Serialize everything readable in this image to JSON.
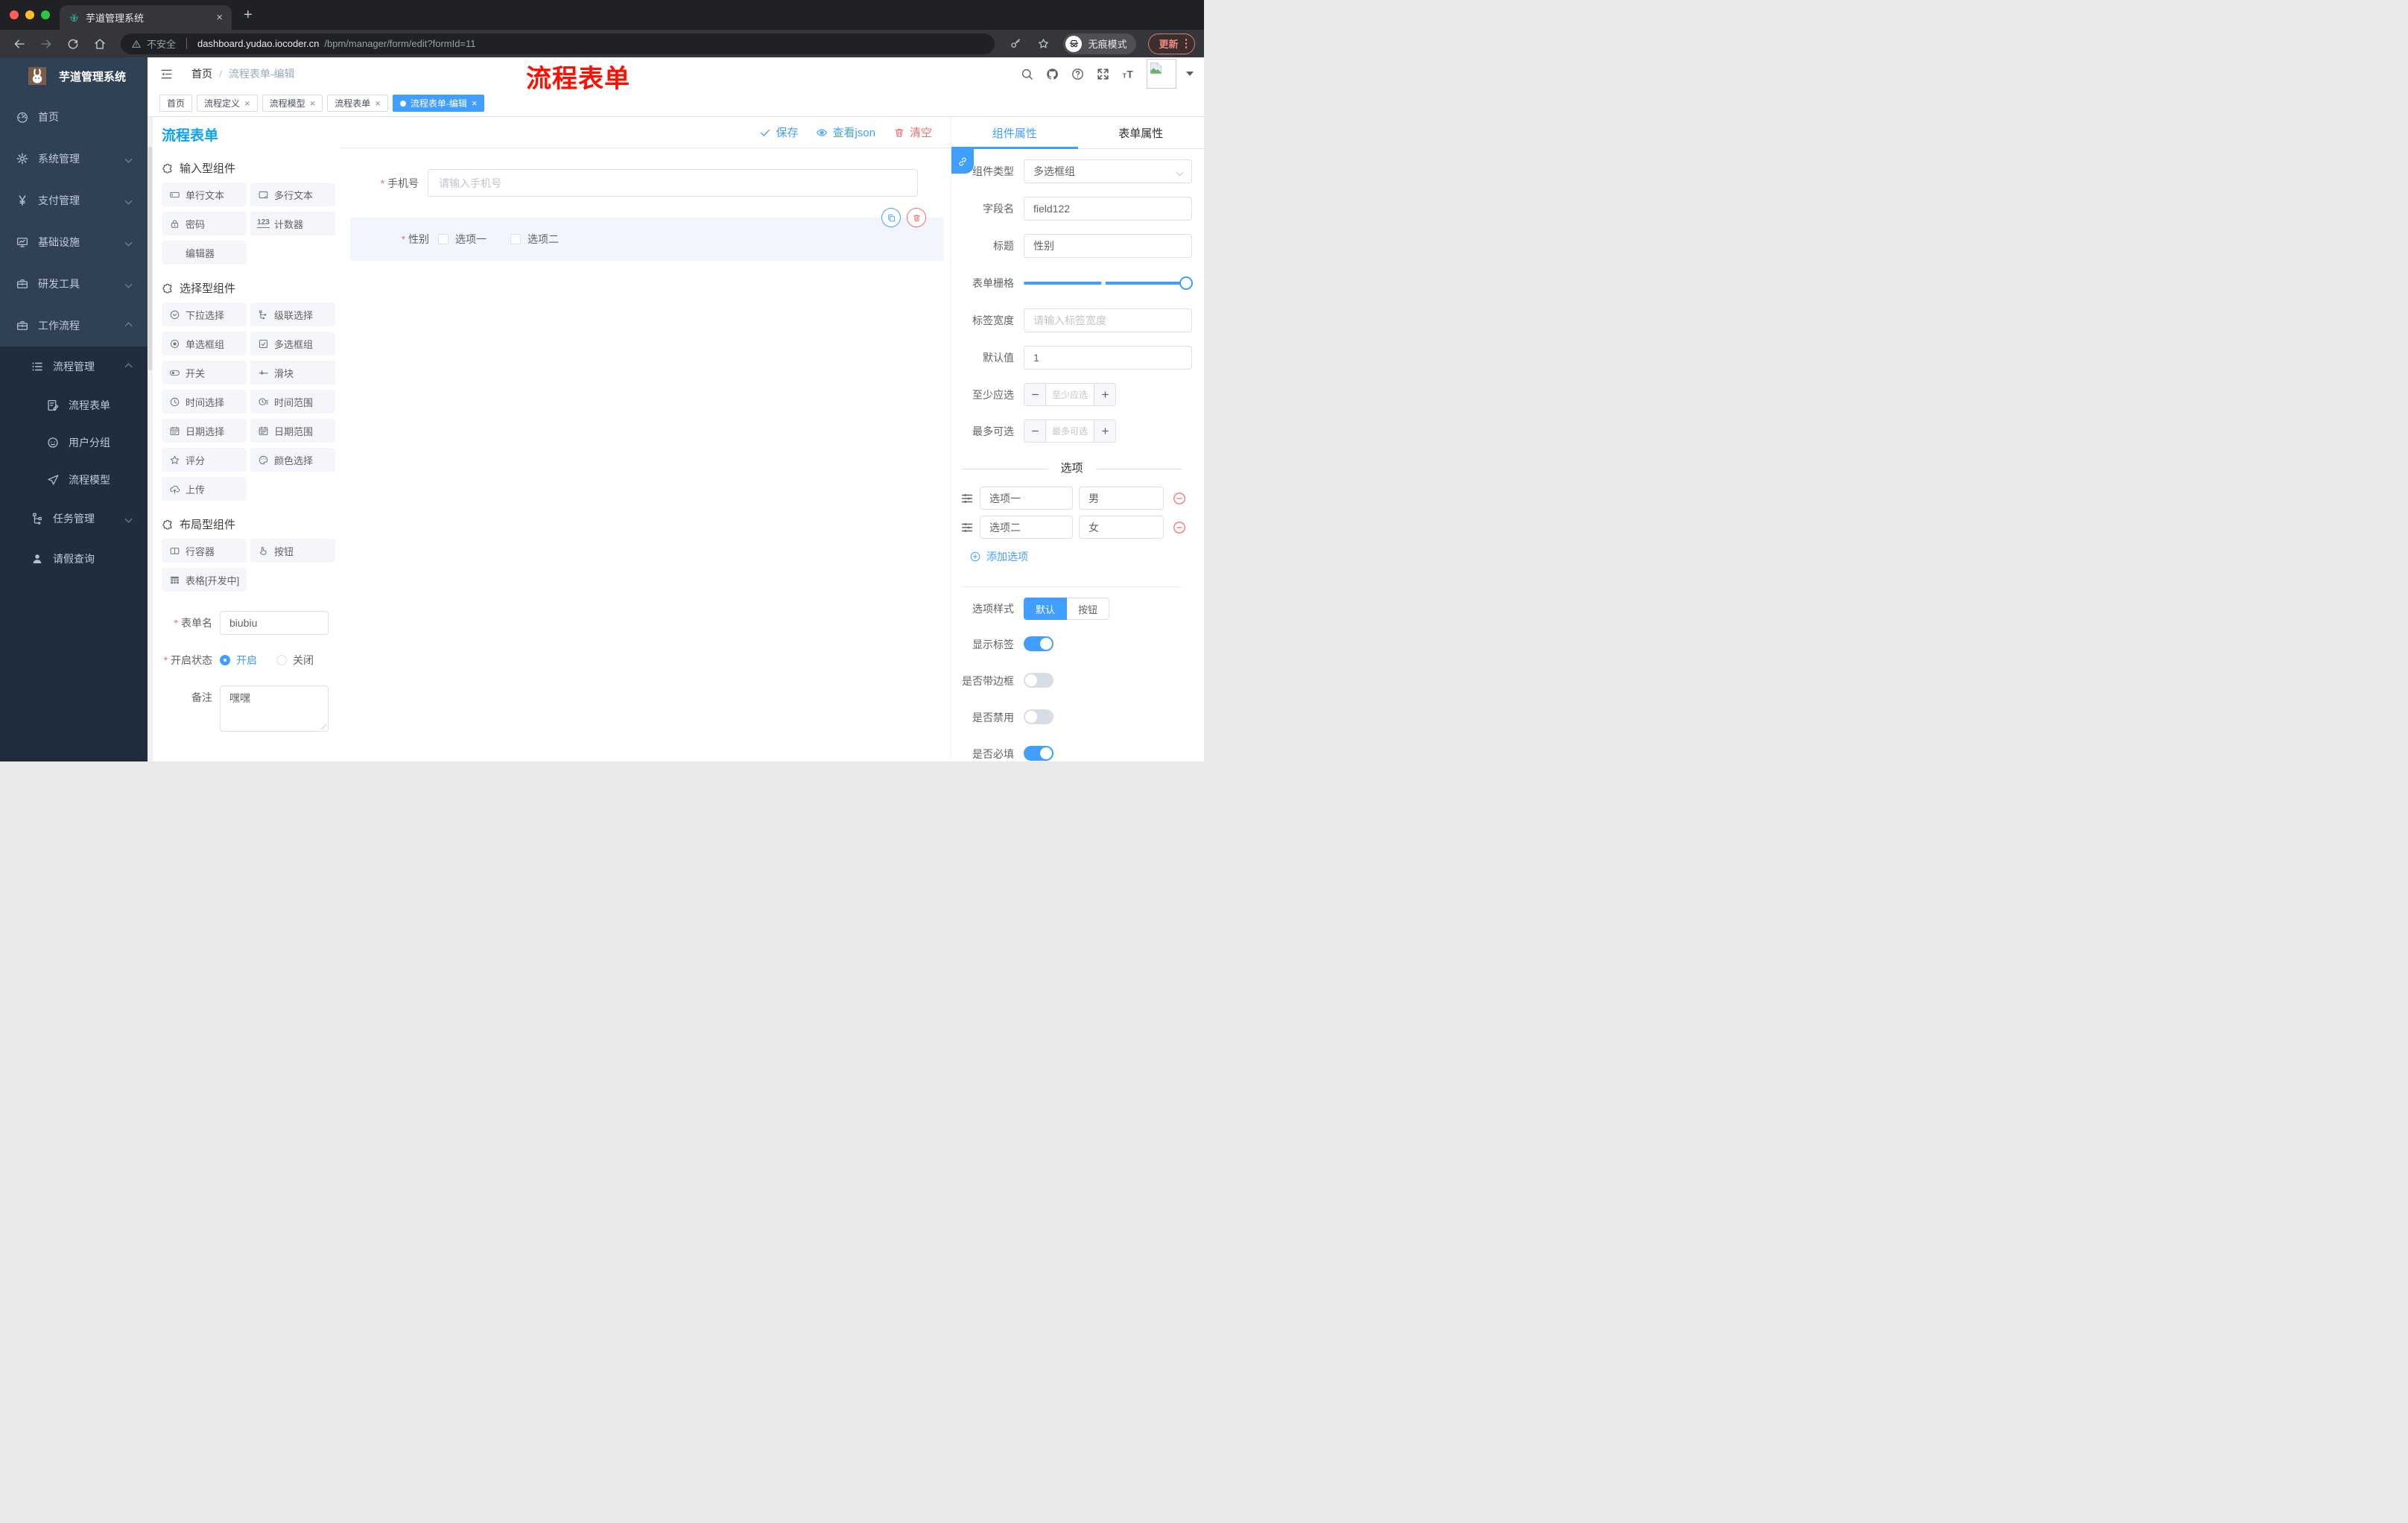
{
  "browser": {
    "tab_title": "芋道管理系统",
    "security_label": "不安全",
    "url_host": "dashboard.yudao.iocoder.cn",
    "url_path": "/bpm/manager/form/edit?formId=11",
    "incognito_label": "无痕模式",
    "update_label": "更新"
  },
  "sidebar": {
    "logo_title": "芋道管理系统",
    "top": [
      {
        "icon": "gauge",
        "label": "首页",
        "arrow": "none",
        "cls": "lvl0"
      },
      {
        "icon": "gear",
        "label": "系统管理",
        "arrow": "down",
        "cls": "lvl0"
      },
      {
        "icon": "yen",
        "label": "支付管理",
        "arrow": "down",
        "cls": "lvl0"
      },
      {
        "icon": "monitor",
        "label": "基础设施",
        "arrow": "down",
        "cls": "lvl0"
      },
      {
        "icon": "toolbox",
        "label": "研发工具",
        "arrow": "down",
        "cls": "lvl0"
      },
      {
        "icon": "toolbox",
        "label": "工作流程",
        "arrow": "up",
        "cls": "lvl0"
      }
    ],
    "sub": [
      {
        "icon": "list",
        "label": "流程管理",
        "arrow": "up",
        "cls": "lvl1"
      },
      {
        "icon": "doc-edit",
        "label": "流程表单",
        "arrow": "none",
        "cls": "lvl2"
      },
      {
        "icon": "face",
        "label": "用户分组",
        "arrow": "none",
        "cls": "lvl2"
      },
      {
        "icon": "send",
        "label": "流程模型",
        "arrow": "none",
        "cls": "lvl2"
      },
      {
        "icon": "tree",
        "label": "任务管理",
        "arrow": "down",
        "cls": "lvl1"
      },
      {
        "icon": "user",
        "label": "请假查询",
        "arrow": "none",
        "cls": "lvl1"
      }
    ]
  },
  "header": {
    "breadcrumb_home": "首页",
    "breadcrumb_current": "流程表单-编辑",
    "annotation": "流程表单"
  },
  "tags": [
    {
      "label": "首页",
      "closable": false,
      "active": false,
      "cls": ""
    },
    {
      "label": "流程定义",
      "closable": true,
      "active": false,
      "cls": ""
    },
    {
      "label": "流程模型",
      "closable": true,
      "active": false,
      "cls": ""
    },
    {
      "label": "流程表单",
      "closable": true,
      "active": false,
      "cls": ""
    },
    {
      "label": "流程表单-编辑",
      "closable": true,
      "active": true,
      "cls": "active"
    }
  ],
  "designer": {
    "title": "流程表单",
    "toolbar": {
      "save": "保存",
      "view_json": "查看json",
      "clear": "清空"
    }
  },
  "palette": {
    "sections": [
      {
        "title": "输入型组件",
        "items": [
          {
            "icon": "input",
            "label": "单行文本"
          },
          {
            "icon": "textarea",
            "label": "多行文本"
          },
          {
            "icon": "lock",
            "label": "密码"
          },
          {
            "icon": "counter",
            "label": "计数器"
          },
          {
            "icon": "blank",
            "label": "编辑器"
          }
        ]
      },
      {
        "title": "选择型组件",
        "items": [
          {
            "icon": "select",
            "label": "下拉选择"
          },
          {
            "icon": "cascader",
            "label": "级联选择"
          },
          {
            "icon": "radio",
            "label": "单选框组"
          },
          {
            "icon": "checkbox",
            "label": "多选框组"
          },
          {
            "icon": "switch",
            "label": "开关"
          },
          {
            "icon": "slider",
            "label": "滑块"
          },
          {
            "icon": "clock",
            "label": "时间选择"
          },
          {
            "icon": "time-range",
            "label": "时间范围"
          },
          {
            "icon": "calendar",
            "label": "日期选择"
          },
          {
            "icon": "date-range",
            "label": "日期范围"
          },
          {
            "icon": "star",
            "label": "评分"
          },
          {
            "icon": "palette",
            "label": "颜色选择"
          },
          {
            "icon": "upload",
            "label": "上传"
          }
        ]
      },
      {
        "title": "布局型组件",
        "items": [
          {
            "icon": "columns",
            "label": "行容器"
          },
          {
            "icon": "pointer",
            "label": "按钮"
          },
          {
            "icon": "table",
            "label": "表格[开发中]"
          }
        ]
      }
    ]
  },
  "left_form": {
    "form_name_label": "表单名",
    "form_name_value": "biubiu",
    "status_label": "开启状态",
    "status_on": "开启",
    "status_off": "关闭",
    "remark_label": "备注",
    "remark_value": "嘿嘿"
  },
  "canvas": {
    "phone_label": "手机号",
    "phone_placeholder": "请输入手机号",
    "gender_label": "性别",
    "gender_options": [
      "选项一",
      "选项二"
    ]
  },
  "props": {
    "tab_component": "组件属性",
    "tab_form": "表单属性",
    "component_type_label": "组件类型",
    "component_type_value": "多选框组",
    "field_name_label": "字段名",
    "field_name_value": "field122",
    "title_label": "标题",
    "title_value": "性别",
    "grid_label": "表单栅格",
    "label_width_label": "标签宽度",
    "label_width_placeholder": "请输入标签宽度",
    "default_label": "默认值",
    "default_value": "1",
    "min_label": "至少应选",
    "min_placeholder": "至少应选",
    "max_label": "最多可选",
    "max_placeholder": "最多可选",
    "options_divider": "选项",
    "options": [
      {
        "label": "选项一",
        "value": "男"
      },
      {
        "label": "选项二",
        "value": "女"
      }
    ],
    "add_option": "添加选项",
    "style_label": "选项样式",
    "style_default": "默认",
    "style_button": "按钮",
    "toggles": [
      {
        "label": "显示标签",
        "on": true
      },
      {
        "label": "是否带边框",
        "on": false
      },
      {
        "label": "是否禁用",
        "on": false
      },
      {
        "label": "是否必填",
        "on": true
      }
    ]
  }
}
